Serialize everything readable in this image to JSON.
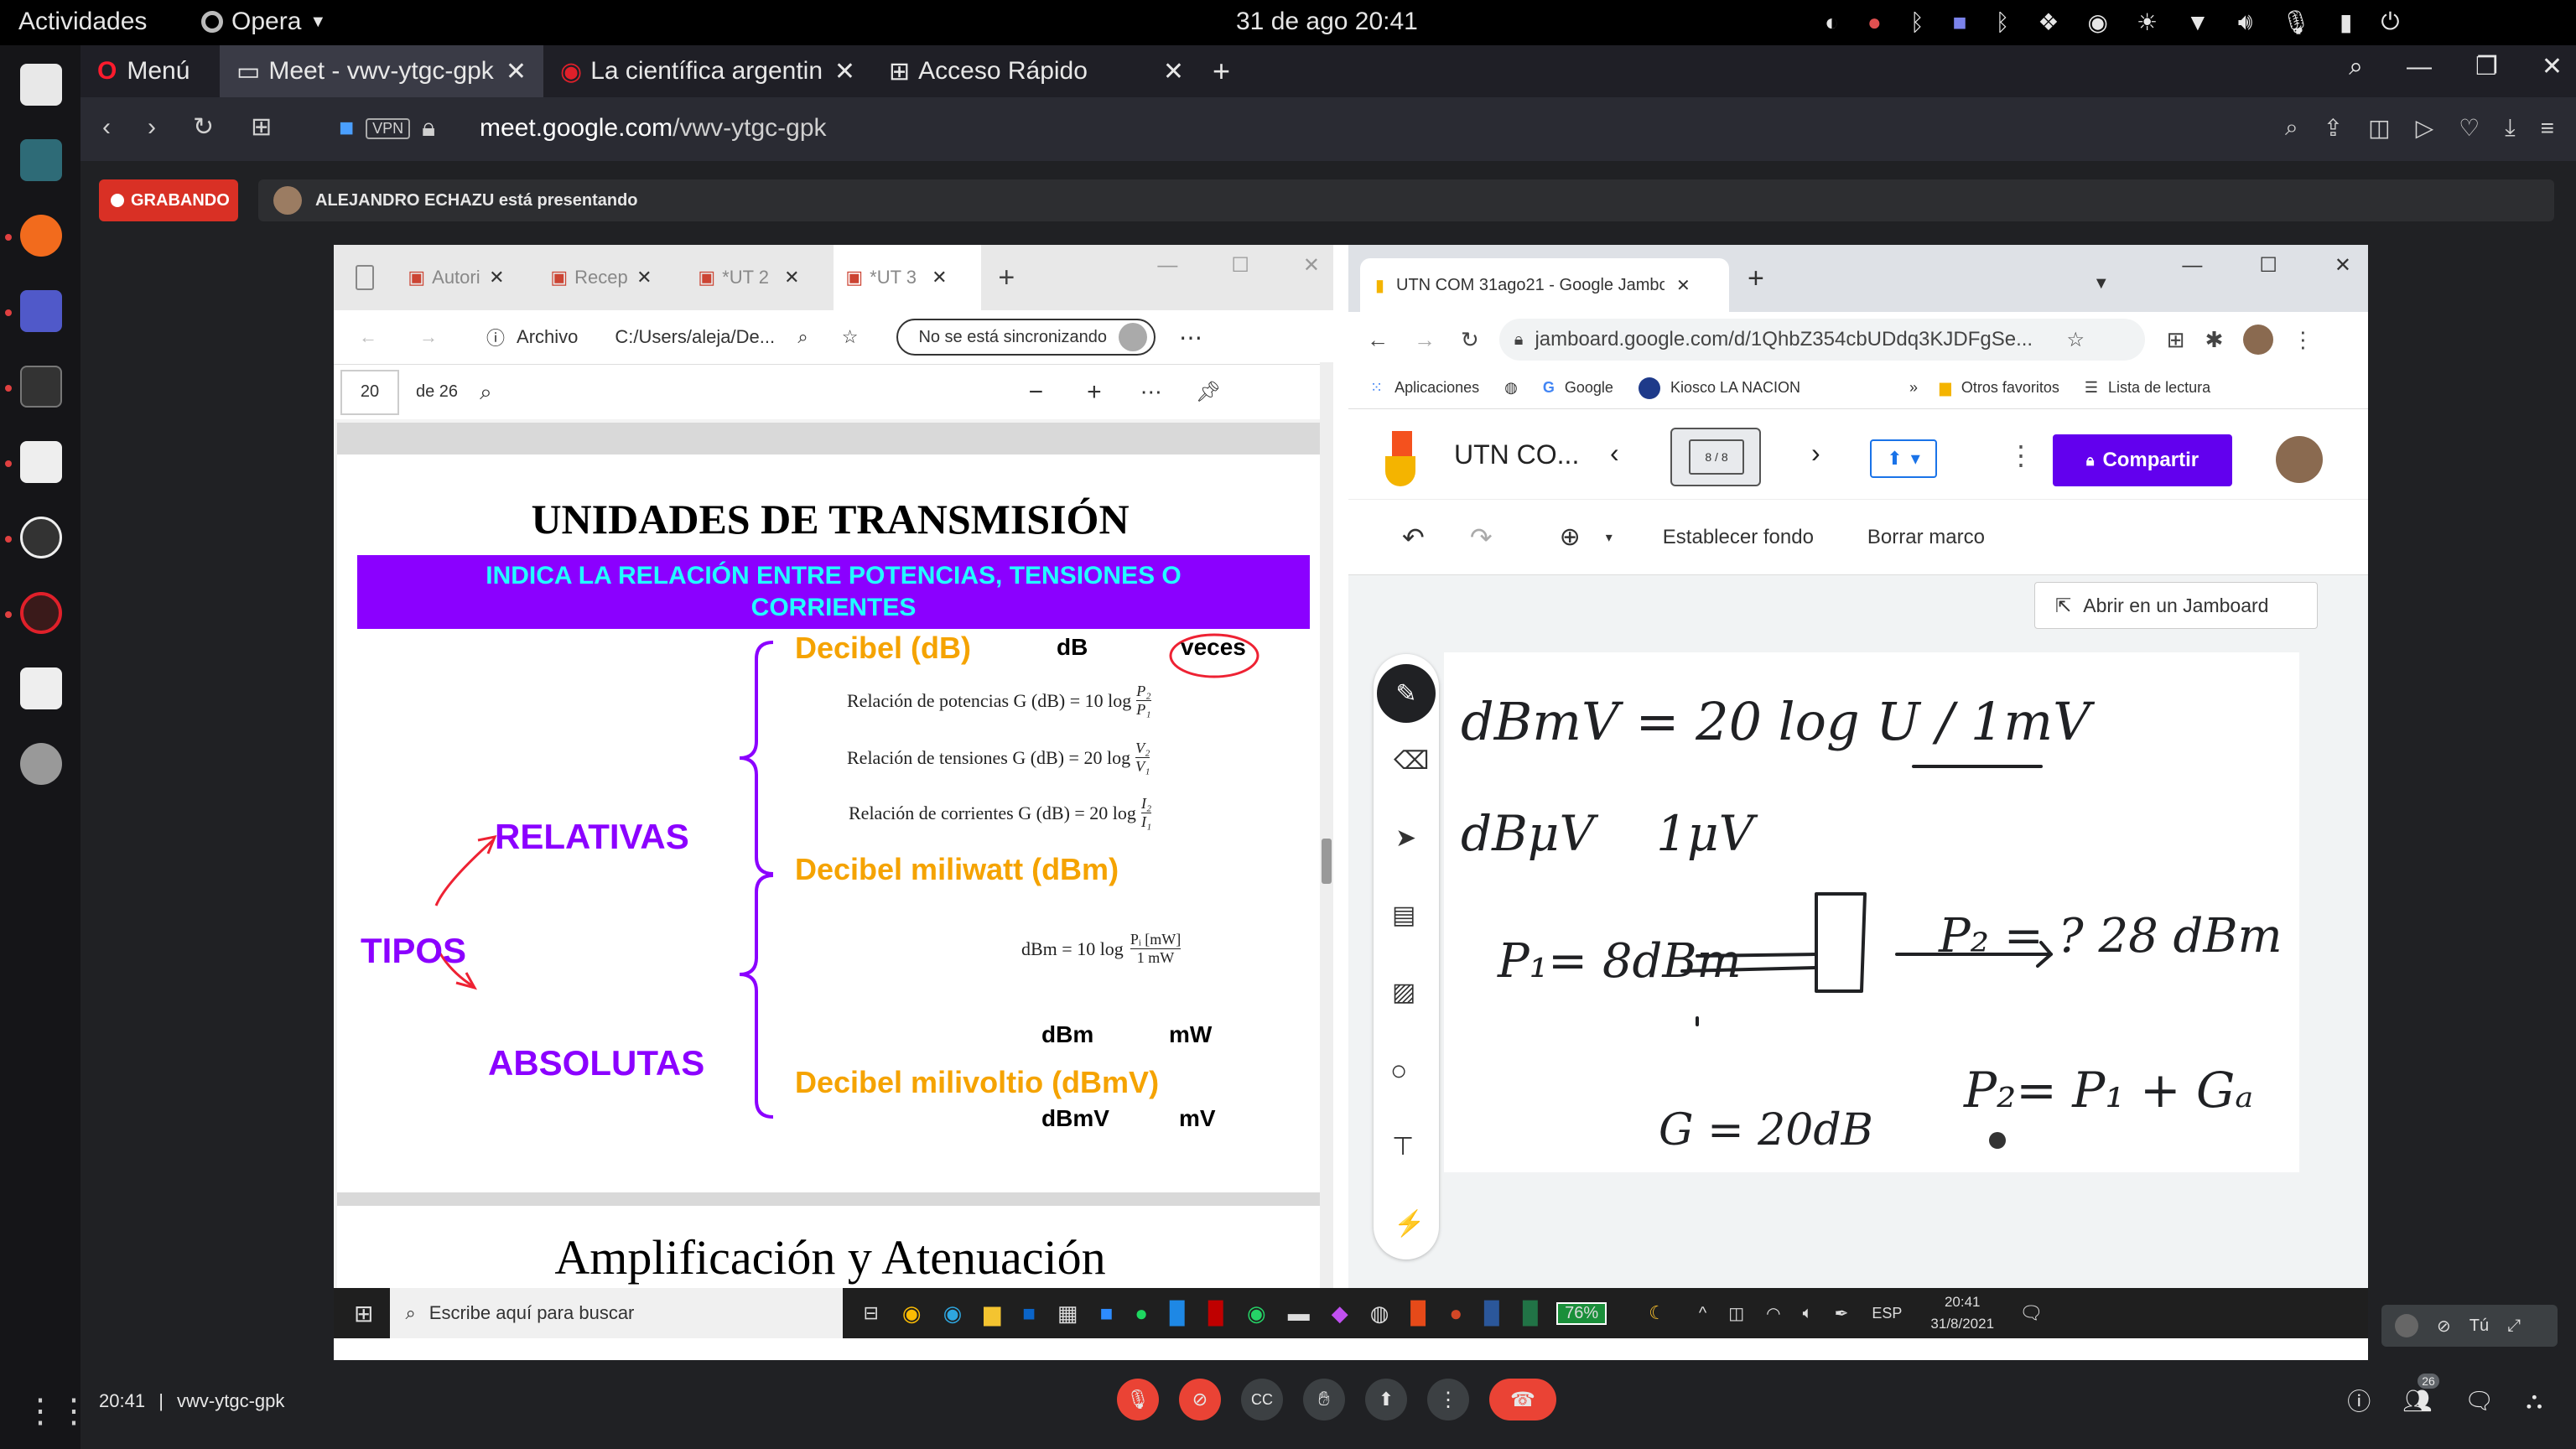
{
  "topbar": {
    "activities": "Actividades",
    "app": "Opera",
    "datetime": "31 de ago  20:41"
  },
  "opera": {
    "menu": "Menú",
    "tabs": [
      {
        "label": "Meet - vwv-ytgc-gpk"
      },
      {
        "label": "La científica argentin"
      },
      {
        "label": "Acceso Rápido"
      }
    ],
    "vpn": "VPN",
    "url_domain": "meet.google.com",
    "url_path": "/vwv-ytgc-gpk"
  },
  "meet": {
    "recording": "GRABANDO",
    "presenting": "ALEJANDRO ECHAZU está presentando",
    "time": "20:41",
    "code": "vwv-ytgc-gpk",
    "participants_count": "26",
    "self_label": "Tú"
  },
  "edge": {
    "tabs": [
      "Autori",
      "Recep",
      "*UT 2",
      "*UT 3"
    ],
    "archivo": "Archivo",
    "path": "C:/Users/aleja/De...",
    "sync": "No se está sincronizando",
    "page": "20",
    "of_pages": "de 26"
  },
  "pdf": {
    "title": "UNIDADES DE TRANSMISIÓN",
    "banner": "INDICA LA RELACIÓN ENTRE POTENCIAS, TENSIONES O CORRIENTES",
    "tipos": "TIPOS",
    "relativas": "RELATIVAS",
    "absolutas": "ABSOLUTAS",
    "decibel": "Decibel (dB)",
    "db": "dB",
    "veces": "veces",
    "rel_pot": "Relación de potencias G (dB) = 10 log",
    "rel_ten": "Relación de tensiones G (dB) = 20 log",
    "rel_cor": "Relación de corrientes G (dB) = 20 log",
    "frac_p_num": "P₂",
    "frac_p_den": "P₁",
    "frac_v_num": "V₂",
    "frac_v_den": "V₁",
    "frac_i_num": "I₂",
    "frac_i_den": "I₁",
    "dbm_title": "Decibel miliwatt (dBm)",
    "dbm_formula": "dBm = 10 log",
    "dbm_num": "Pᵢ [mW]",
    "dbm_den": "1 mW",
    "dbm": "dBm",
    "mw": "mW",
    "dbmv_title": "Decibel milivoltio (dBmV)",
    "dbmv": "dBmV",
    "mv": "mV",
    "next_title": "Amplificación y Atenuación"
  },
  "chrome": {
    "tab": "UTN COM 31ago21 - Google Jambo",
    "url": "jamboard.google.com/d/1QhbZ354cbUDdq3KJDFgSe...",
    "bookmarks": [
      "Aplicaciones",
      "Google",
      "Kiosco LA NACION"
    ],
    "otros": "Otros favoritos",
    "lista": "Lista de lectura"
  },
  "jamboard": {
    "title": "UTN CO...",
    "frame": "8 / 8",
    "share": "Compartir",
    "set_bg": "Establecer fondo",
    "clear": "Borrar marco",
    "open": "Abrir en un Jamboard"
  },
  "handwriting": {
    "line1": "dBmV = 20 log U / 1mV",
    "line2": "dBμV    1μV",
    "p1": "P₁= 8dBm",
    "p2": "P₂ = ? 28 dBm",
    "gain": "G = 20dB",
    "eq": "P₂= P₁ + Gₐ"
  },
  "taskbar": {
    "search": "Escribe aquí para buscar",
    "battery": "76%",
    "lang": "ESP",
    "time": "20:41",
    "date": "31/8/2021"
  }
}
